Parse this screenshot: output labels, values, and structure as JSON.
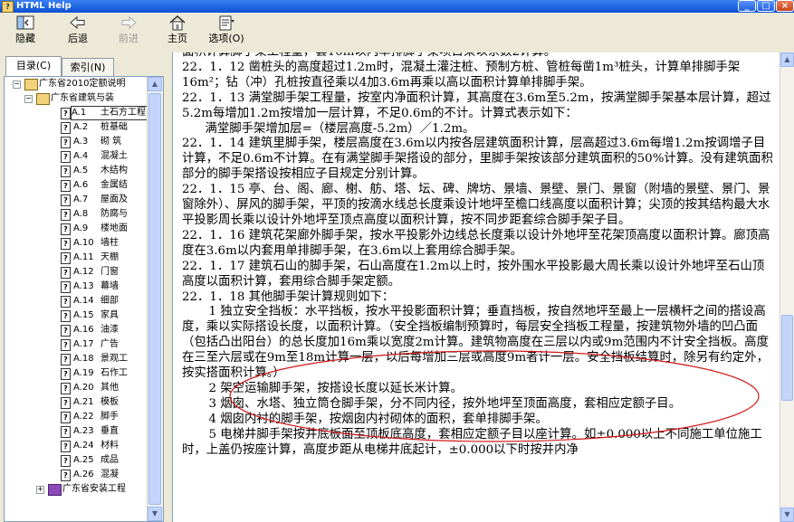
{
  "window": {
    "title": "HTML Help",
    "app_icon": "help-book-icon"
  },
  "toolbar": {
    "hide_label": "隐藏",
    "back_label": "后退",
    "forward_label": "前进",
    "home_label": "主页",
    "options_label": "选项(O)"
  },
  "nav": {
    "tabs": [
      {
        "label": "目录(C)"
      },
      {
        "label": "索引(N)"
      }
    ],
    "tree": {
      "root": "广东省2010定额说明",
      "sub": "广东省建筑与装",
      "items": [
        {
          "code": "A.1",
          "name": "土石方工程"
        },
        {
          "code": "A.2",
          "name": "桩基础"
        },
        {
          "code": "A.3",
          "name": "砌  筑"
        },
        {
          "code": "A.4",
          "name": "混凝土"
        },
        {
          "code": "A.5",
          "name": "木结构"
        },
        {
          "code": "A.6",
          "name": "金属结"
        },
        {
          "code": "A.7",
          "name": "屋面及"
        },
        {
          "code": "A.8",
          "name": "防腐与"
        },
        {
          "code": "A.9",
          "name": "楼地面"
        },
        {
          "code": "A.10",
          "name": "墙柱"
        },
        {
          "code": "A.11",
          "name": "天棚"
        },
        {
          "code": "A.12",
          "name": "门窗"
        },
        {
          "code": "A.13",
          "name": "幕墙"
        },
        {
          "code": "A.14",
          "name": "细部"
        },
        {
          "code": "A.15",
          "name": "家具"
        },
        {
          "code": "A.16",
          "name": "油漆"
        },
        {
          "code": "A.17",
          "name": "广告"
        },
        {
          "code": "A.18",
          "name": "景观工"
        },
        {
          "code": "A.19",
          "name": "石作工"
        },
        {
          "code": "A.20",
          "name": "其他"
        },
        {
          "code": "A.21",
          "name": "模板"
        },
        {
          "code": "A.22",
          "name": "脚手"
        },
        {
          "code": "A.23",
          "name": "垂直"
        },
        {
          "code": "A.24",
          "name": "材料"
        },
        {
          "code": "A.25",
          "name": "成品"
        },
        {
          "code": "A.26",
          "name": "混凝"
        }
      ],
      "last": "广东省安装工程"
    }
  },
  "content": {
    "paragraphs": [
      {
        "cls": "",
        "text": "面积计算脚手架工程量，套10m以内单排脚手架项目乘以系数2计算。"
      },
      {
        "cls": "",
        "text": "22．1．12  凿桩头的高度超过1.2m时，混凝土灌注桩、预制方桩、管桩每凿1m³桩头，计算单排脚手架16m²；钻（冲）孔桩按直径乘以4加3.6m再乘以高以面积计算单排脚手架。"
      },
      {
        "cls": "",
        "text": "22．1．13  满堂脚手架工程量，按室内净面积计算，其高度在3.6m至5.2m，按满堂脚手架基本层计算，超过5.2m每增加1.2m按增加一层计算，不足0.6m的不计。计算式表示如下："
      },
      {
        "cls": "ind",
        "text": "满堂脚手架增加层=（楼层高度-5.2m）／1.2m。"
      },
      {
        "cls": "",
        "text": "22．1．14  建筑里脚手架，楼层高度在3.6m以内按各层建筑面积计算，层高超过3.6m每增1.2m按调增子目计算，不足0.6m不计算。在有满堂脚手架搭设的部分，里脚手架按该部分建筑面积的50%计算。没有建筑面积部分的脚手架搭设按相应子目规定分别计算。"
      },
      {
        "cls": "",
        "text": "22．1．15  亭、台、阁、廊、榭、舫、塔、坛、碑、牌坊、景墙、景壁、景门、景窗（附墙的景壁、景门、景窗除外）、屏风的脚手架，平顶的按滴水线总长度乘设计地坪至檐口线高度以面积计算；尖顶的按其结构最大水平投影周长乘以设计外地坪至顶点高度以面积计算，按不同步距套综合脚手架子目。"
      },
      {
        "cls": "",
        "text": "22．1．16  建筑花架廊外脚手架，按水平投影外边线总长度乘以设计外地坪至花架顶高度以面积计算。廊顶高度在3.6m以内套用单排脚手架，在3.6m以上套用综合脚手架。"
      },
      {
        "cls": "",
        "text": "22．1．17  建筑石山的脚手架，石山高度在1.2m以上时，按外围水平投影最大周长乘以设计外地坪至石山顶高度以面积计算，套用综合脚手架定额。"
      },
      {
        "cls": "",
        "text": "22．1．18  其他脚手架计算规则如下："
      },
      {
        "cls": "ind2",
        "text": "1  独立安全挡板：水平挡板，按水平投影面积计算；垂直挡板，按自然地坪至最上一层横杆之间的搭设高度，乘以实际搭设长度，以面积计算。（安全挡板编制预算时，每层安全挡板工程量，按建筑物外墙的凹凸面（包括凸出阳台）的总长度加16m乘以宽度2m计算。建筑物高度在三层以内或9m范围内不计安全挡板。高度在三至六层或在9m至18m计算一层，以后每增加三层或高度9m者计一层。安全挡板结算时，除另有约定外，按实搭面积计算。）"
      },
      {
        "cls": "ind2",
        "text": "2  架空运输脚手架，按搭设长度以延长米计算。"
      },
      {
        "cls": "ind2",
        "text": "3  烟囱、水塔、独立筒仓脚手架，分不同内径，按外地坪至顶面高度，套相应定额子目。"
      },
      {
        "cls": "ind2",
        "text": "4  烟囱内衬的脚手架，按烟囱内衬砌体的面积，套单排脚手架。"
      },
      {
        "cls": "ind2",
        "text": "5  电梯井脚手架按井底板面至顶板底高度，套相应定额子目以座计算。如±0.000以上不同施工单位施工时，上盖仍按座计算，高度步距从电梯井底起计，±0.000以下时按井内净"
      }
    ]
  }
}
